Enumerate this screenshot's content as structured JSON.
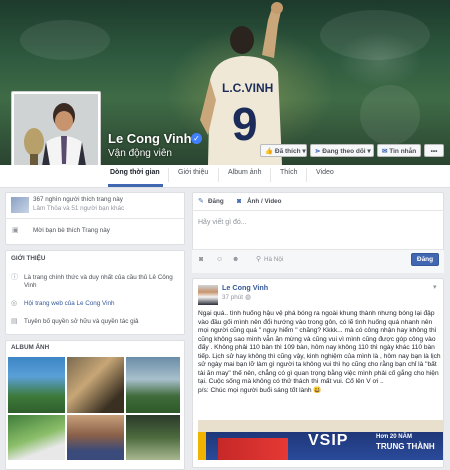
{
  "profile": {
    "name": "Le Cong Vinh",
    "category": "Vận động viên",
    "verified_icon": "check-icon",
    "jersey_text": "L.C.VINH",
    "jersey_number": "9"
  },
  "cover_actions": {
    "like": "Đã thích",
    "follow": "Đang theo dõi",
    "message": "Tin nhắn",
    "more": "•••"
  },
  "tabs": [
    "Dòng thời gian",
    "Giới thiệu",
    "Album ảnh",
    "Thích",
    "Video"
  ],
  "likes_card": {
    "line1": "367 nghìn người thích trang này",
    "line2": "Lâm Thỏa và 51 người bạn khác",
    "invite": "Mời bạn bè thích Trang này"
  },
  "about": {
    "title": "GIỚI THIỆU",
    "description": "Là trang chính thức và duy nhất của cầu thủ Lê Công Vinh",
    "website": "Hội trang web của Le Cong Vinh",
    "copyright": "Tuyên bố quyền sở hữu và quyền tác giả"
  },
  "album": {
    "title": "ALBUM ẢNH"
  },
  "composer": {
    "status_tab": "Đăng",
    "photo_tab": "Ảnh / Video",
    "placeholder": "Hãy viết gì đó...",
    "location": "Hà Nội",
    "post_button": "Đăng"
  },
  "post": {
    "author": "Le Cong Vinh",
    "time": "37 phút",
    "body": "Ngại quá.. tình huống hậu vệ phá bóng ra ngoài khung thành nhưng bóng lại đập vào đầu gối mình nên đổi hướng vào trong gôn, có lẽ tình huống quá nhanh nên mọi người cũng quá \" nguy hiểm \" chăng? Kkkk... mà có công nhận hay không thì cũng không sao mình vẫn ăn mừng và cũng vui vì mình cũng được góp công vào đấy . Không phải 110 bàn thì 109 bàn, hôm nay không 110 thì ngày khác 110 bàn tiếp. Lịch sử hay không thì cũng vậy, kinh nghiệm của mình là , hôm nay bạn là lịch sử ngày mai bạn lỡ làm gì người ta không vui thì họ cũng cho rằng bạn chỉ là \"bất tài ăn may\" thế nên, chẳng có gì quan trọng bằng việc mình phải cố gắng cho hiện tại. Cuộc sống mà không có thử thách thì mất vui. Cố lên V ơi ..\np/s: Chúc mọi người buổi sáng tốt lành 😃",
    "banner_text": "VSIP",
    "banner_text2": "Hơn 20 NĂM",
    "banner_text3": "TRUNG THÀNH"
  },
  "colors": {
    "facebook_blue": "#4267b2",
    "link": "#365899",
    "background": "#e9ebee"
  }
}
